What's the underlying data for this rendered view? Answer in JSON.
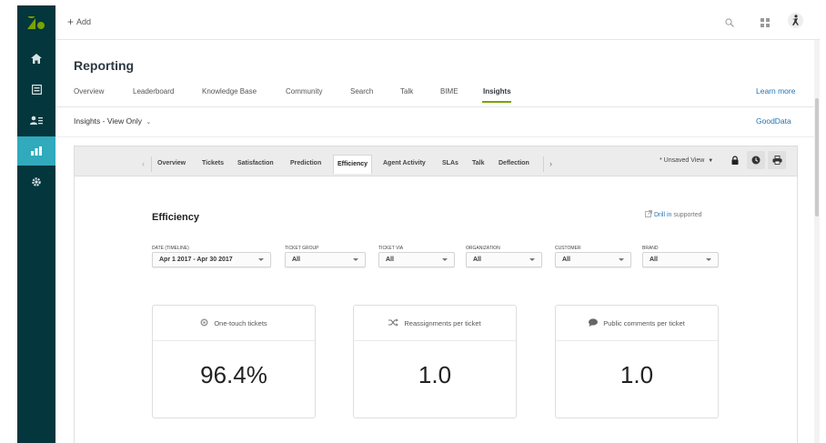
{
  "topbar": {
    "add_label": "Add"
  },
  "page": {
    "title": "Reporting"
  },
  "reporting_tabs": [
    {
      "label": "Overview"
    },
    {
      "label": "Leaderboard"
    },
    {
      "label": "Knowledge Base"
    },
    {
      "label": "Community"
    },
    {
      "label": "Search"
    },
    {
      "label": "Talk"
    },
    {
      "label": "BIME"
    },
    {
      "label": "Insights",
      "active": true
    }
  ],
  "learn_more": "Learn more",
  "view_selector": "Insights - View Only",
  "gooddata_link": "GoodData",
  "insights_tabs": [
    {
      "label": "Overview"
    },
    {
      "label": "Tickets"
    },
    {
      "label": "Satisfaction"
    },
    {
      "label": "Prediction"
    },
    {
      "label": "Efficiency",
      "active": true
    },
    {
      "label": "Agent Activity"
    },
    {
      "label": "SLAs"
    },
    {
      "label": "Talk"
    },
    {
      "label": "Deflection"
    }
  ],
  "view_state": "* Unsaved View",
  "dashboard": {
    "title": "Efficiency",
    "drill_link": "Drill in",
    "drill_suffix": "supported"
  },
  "filters": [
    {
      "label": "DATE (TIMELINE)",
      "value": "Apr 1 2017 - Apr 30 2017"
    },
    {
      "label": "TICKET GROUP",
      "value": "All"
    },
    {
      "label": "TICKET VIA",
      "value": "All"
    },
    {
      "label": "ORGANIZATION",
      "value": "All"
    },
    {
      "label": "CUSTOMER",
      "value": "All"
    },
    {
      "label": "BRAND",
      "value": "All"
    }
  ],
  "kpis": [
    {
      "title": "One-touch tickets",
      "value": "96.4%",
      "icon": "target-icon"
    },
    {
      "title": "Reassignments per ticket",
      "value": "1.0",
      "icon": "shuffle-icon"
    },
    {
      "title": "Public comments per ticket",
      "value": "1.0",
      "icon": "comment-icon"
    }
  ],
  "colors": {
    "nav_bg": "#03363d",
    "nav_active": "#30aabc",
    "accent_green": "#78a300",
    "link_blue": "#1f73b7"
  }
}
